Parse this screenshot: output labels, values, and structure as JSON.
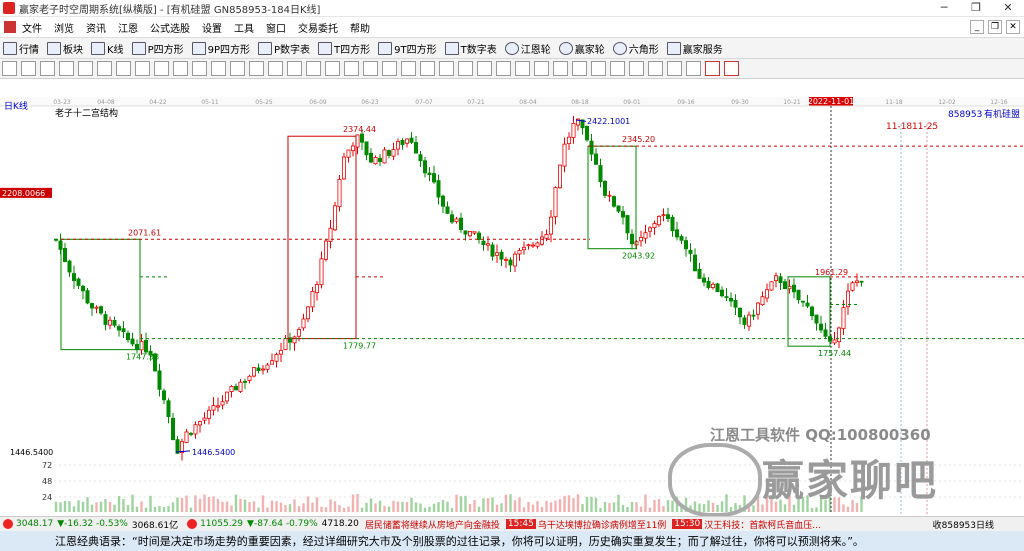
{
  "window": {
    "title": "赢家老子时空周期系统[纵横版] - [有机硅盟  GN858953-184日K线]",
    "minimize": "─",
    "maximize": "❐",
    "close": "✕"
  },
  "menu": {
    "items": [
      "文件",
      "浏览",
      "资讯",
      "江恩",
      "公式选股",
      "设置",
      "工具",
      "窗口",
      "交易委托",
      "帮助"
    ],
    "right_buttons": [
      "_",
      "❐",
      "✕"
    ]
  },
  "toolbar": {
    "items": [
      "行情",
      "板块",
      "K线",
      "P四方形",
      "9P四方形",
      "P数字表",
      "T四方形",
      "9T四方形",
      "T数字表",
      "江恩轮",
      "赢家轮",
      "六角形",
      "赢家服务"
    ]
  },
  "chart": {
    "period_label": "日K线",
    "structure_label": "老子十二宫结构",
    "code_label": "858953",
    "name_label": "有机硅盟",
    "cursor_date": "2022-11-01",
    "future_labels": [
      "11-18",
      "11-25"
    ],
    "left_price_tag": "2208.0066",
    "bottom_price_tag": "1446.5400",
    "volume_ticks": [
      "72",
      "48",
      "24"
    ],
    "x_dates": [
      "03-23",
      "04-08",
      "04-22",
      "05-11",
      "05-25",
      "06-09",
      "06-23",
      "07-07",
      "07-21",
      "08-04",
      "08-18",
      "09-01",
      "09-16",
      "09-30",
      "10-21",
      "2022-11-01",
      "11-18",
      "12-02",
      "12-16"
    ],
    "annotations": {
      "a1": "2071.61",
      "a2": "1747.38",
      "a3": "2374.44",
      "a4": "1779.77",
      "a5": "2422.1001",
      "a6": "2345.20",
      "a7": "2043.92",
      "a8": "1961.29",
      "a9": "1757.44",
      "a10": "1446.5400"
    }
  },
  "watermark": {
    "line1": "江恩工具软件  QQ:100800360",
    "line2": "赢家聊吧"
  },
  "ticker": {
    "idx1": "3048.17",
    "idx1_chg": "▼-16.32 -0.53%",
    "idx1_vol": "3068.61亿",
    "idx2": "11055.29",
    "idx2_chg": "▼-87.64 -0.79%",
    "idx2_vol": "4718.20",
    "news1": "居民储蓄将继续从房地产向金融投",
    "time1": "15:45",
    "news2": "乌干达埃博拉确诊病例增至11例",
    "time2": "15:30",
    "news3": "汉王科技：首款柯氏音血压...",
    "status": "收858953日线"
  },
  "footer": {
    "quote": "江恩经典语录：“时间是决定市场走势的重要因素，经过详细研究大市及个别股票的过往记录，你将可以证明，历史确实重复发生；而了解过往，你将可以预测将来。”。"
  }
}
